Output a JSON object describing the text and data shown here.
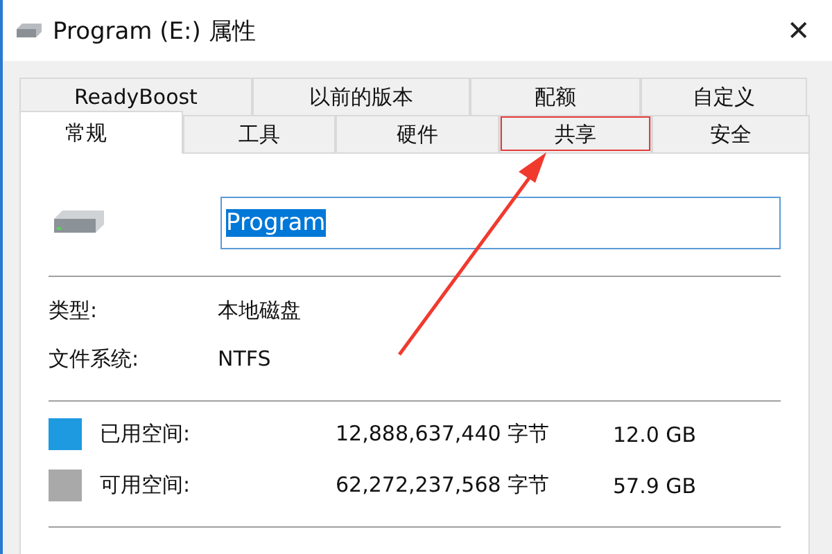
{
  "window": {
    "title": "Program (E:) 属性",
    "close": "✕"
  },
  "tab_rows": [
    [
      {
        "label": "ReadyBoost",
        "selected": false,
        "annotated": false
      },
      {
        "label": "以前的版本",
        "selected": false,
        "annotated": false
      },
      {
        "label": "配额",
        "selected": false,
        "annotated": false
      },
      {
        "label": "自定义",
        "selected": false,
        "annotated": false
      }
    ],
    [
      {
        "label": "常规",
        "selected": true,
        "annotated": false
      },
      {
        "label": "工具",
        "selected": false,
        "annotated": false
      },
      {
        "label": "硬件",
        "selected": false,
        "annotated": false
      },
      {
        "label": "共享",
        "selected": false,
        "annotated": true
      },
      {
        "label": "安全",
        "selected": false,
        "annotated": false
      }
    ]
  ],
  "name_field": {
    "value": "Program",
    "selected_text": true
  },
  "info": [
    {
      "label": "类型:",
      "value": "本地磁盘"
    },
    {
      "label": "文件系统:",
      "value": "NTFS"
    }
  ],
  "space": [
    {
      "label": "已用空间:",
      "bytes": "12,888,637,440 字节",
      "size": "12.0 GB",
      "color": "#1e9ae0"
    },
    {
      "label": "可用空间:",
      "bytes": "62,272,237,568 字节",
      "size": "57.9 GB",
      "color": "#a9a9a9"
    }
  ]
}
